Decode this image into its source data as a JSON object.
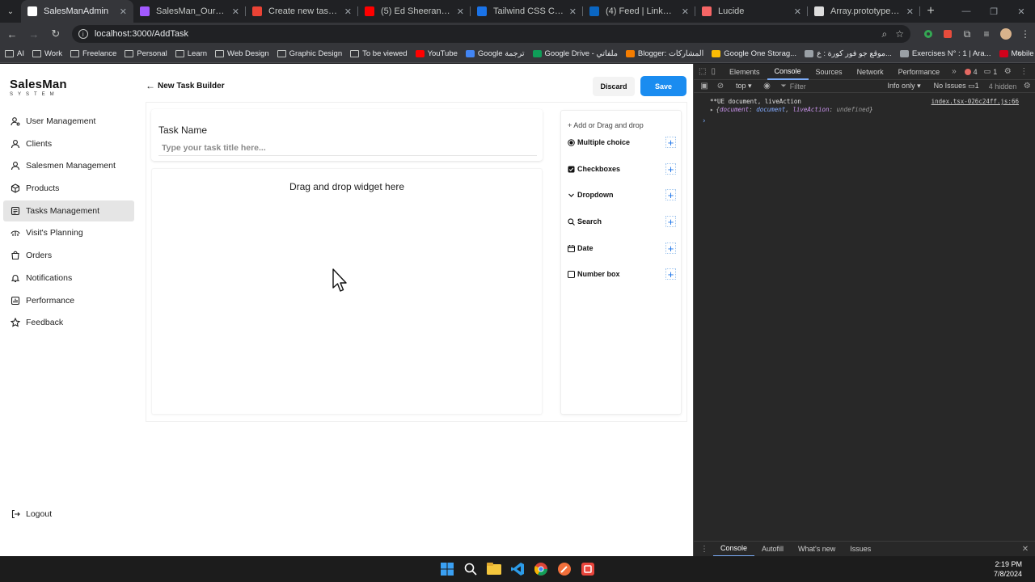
{
  "browser": {
    "tabs": [
      {
        "title": "SalesManAdmin",
        "active": true,
        "favicon_color": "#ffffff"
      },
      {
        "title": "SalesMan_Ours – Figma",
        "active": false,
        "favicon_color": "#a259ff"
      },
      {
        "title": "Create new task | #86enm",
        "active": false,
        "favicon_color": "#ea4335"
      },
      {
        "title": "(5) Ed Sheeran - Perfect (",
        "active": false,
        "favicon_color": "#ff0000"
      },
      {
        "title": "Tailwind CSS Cheat Sheet",
        "active": false,
        "favicon_color": "#1a73e8"
      },
      {
        "title": "(4) Feed | LinkedIn",
        "active": false,
        "favicon_color": "#0a66c2"
      },
      {
        "title": "Lucide",
        "active": false,
        "favicon_color": "#f56565"
      },
      {
        "title": "Array.prototype.toSpliced",
        "active": false,
        "favicon_color": "#dddddd"
      }
    ],
    "url": "localhost:3000/AddTask",
    "bookmarks": [
      {
        "label": "AI",
        "icon": "folder-icon"
      },
      {
        "label": "Work",
        "icon": "folder-icon"
      },
      {
        "label": "Freelance",
        "icon": "folder-icon"
      },
      {
        "label": "Personal",
        "icon": "folder-icon"
      },
      {
        "label": "Learn",
        "icon": "folder-icon"
      },
      {
        "label": "Web Design",
        "icon": "folder-icon"
      },
      {
        "label": "Graphic Design",
        "icon": "folder-icon"
      },
      {
        "label": "To be viewed",
        "icon": "folder-icon"
      },
      {
        "label": "YouTube",
        "icon": "youtube-icon"
      },
      {
        "label": "Google ترجمة",
        "icon": "translate-icon"
      },
      {
        "label": "Google Drive - ملفاتي",
        "icon": "drive-icon"
      },
      {
        "label": "Blogger: المشاركات",
        "icon": "blogger-icon"
      },
      {
        "label": "Google One Storag...",
        "icon": "google-one-icon"
      },
      {
        "label": "موقع جو فور كورة : ع...",
        "icon": "site-icon"
      },
      {
        "label": "Exercises N° : 1 | Ara...",
        "icon": "site-icon"
      },
      {
        "label": "Mobile WiFi",
        "icon": "huawei-icon"
      }
    ]
  },
  "app": {
    "logo": {
      "main": "SalesMan",
      "sub": "SYSTEM"
    },
    "nav": [
      {
        "label": "User Management",
        "icon": "user-gear-icon",
        "active": false
      },
      {
        "label": "Clients",
        "icon": "user-icon",
        "active": false
      },
      {
        "label": "Salesmen Management",
        "icon": "user-icon",
        "active": false
      },
      {
        "label": "Products",
        "icon": "package-icon",
        "active": false
      },
      {
        "label": "Tasks Management",
        "icon": "clipboard-icon",
        "active": true
      },
      {
        "label": "Visit's Planning",
        "icon": "route-icon",
        "active": false
      },
      {
        "label": "Orders",
        "icon": "shopping-bag-icon",
        "active": false
      },
      {
        "label": "Notifications",
        "icon": "bell-icon",
        "active": false
      },
      {
        "label": "Performance",
        "icon": "chart-icon",
        "active": false
      },
      {
        "label": "Feedback",
        "icon": "star-icon",
        "active": false
      }
    ],
    "logout_label": "Logout",
    "header": {
      "title": "New Task Builder",
      "discard": "Discard",
      "save": "Save"
    },
    "task": {
      "label": "Task Name",
      "placeholder": "Type your task title here..."
    },
    "dropzone_text": "Drag and drop widget here",
    "widgets_head": "+ Add or Drag and drop",
    "widgets": [
      {
        "label": "Multiple choice",
        "icon": "radio-icon"
      },
      {
        "label": "Checkboxes",
        "icon": "checkbox-icon"
      },
      {
        "label": "Dropdown",
        "icon": "chevron-down-icon"
      },
      {
        "label": "Search",
        "icon": "search-icon"
      },
      {
        "label": "Date",
        "icon": "calendar-icon"
      },
      {
        "label": "Number box",
        "icon": "square-icon"
      }
    ],
    "accent": "#1a8cf0"
  },
  "devtools": {
    "tabs": [
      "Elements",
      "Console",
      "Sources",
      "Network",
      "Performance"
    ],
    "active_tab": "Console",
    "error_count": "4",
    "message_count": "1",
    "context": "top",
    "filter_placeholder": "Filter",
    "level": "Info only",
    "issues": "No Issues",
    "issue_count": "1",
    "hidden": "4 hidden",
    "log_text": "**UE document, liveAction",
    "log_source": "index.tsx-026c24ff.js:66",
    "log_obj": {
      "open": "{",
      "k1": "document",
      "v1": "document",
      "k2": "liveAction",
      "v2": "undefined",
      "close": "}"
    },
    "drawer_tabs": [
      "Console",
      "Autofill",
      "What's new",
      "Issues"
    ]
  },
  "taskbar": {
    "time": "2:19 PM",
    "date": "7/8/2024"
  }
}
